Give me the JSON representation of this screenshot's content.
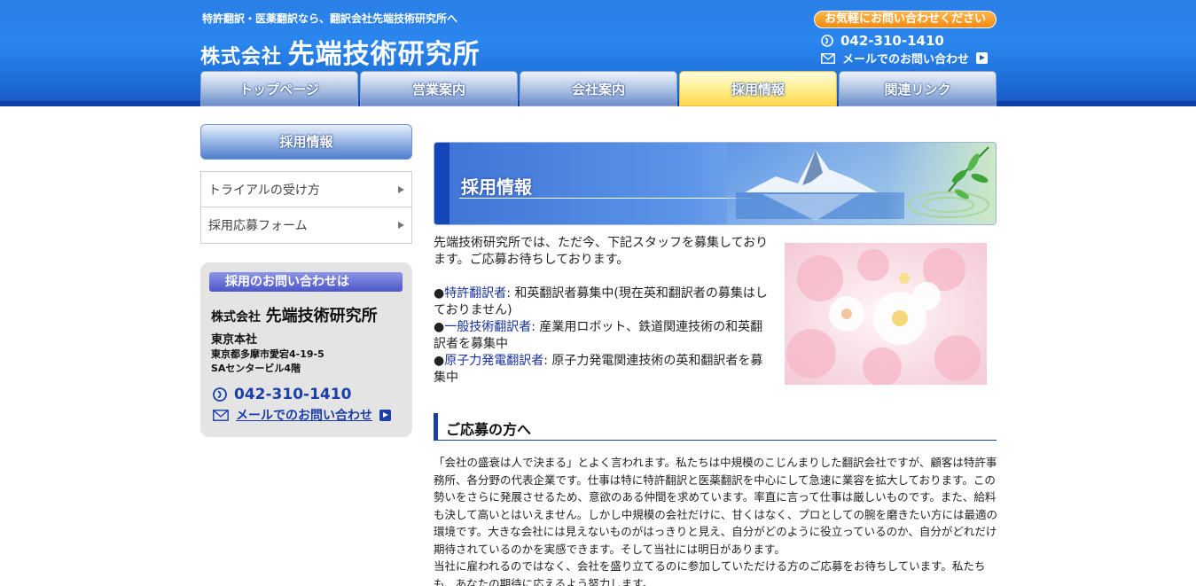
{
  "header": {
    "tagline": "特許翻訳・医薬翻訳なら、翻訳会社先端技術研究所へ",
    "brand_prefix": "株式会社",
    "brand_name": "先端技術研究所",
    "contact_pill": "お気軽にお問い合わせください",
    "phone": "042-310-1410",
    "mail_link": "メールでのお問い合わせ"
  },
  "nav": {
    "tabs": [
      {
        "label": "トップページ",
        "active": false
      },
      {
        "label": "営業案内",
        "active": false
      },
      {
        "label": "会社案内",
        "active": false
      },
      {
        "label": "採用情報",
        "active": true
      },
      {
        "label": "関連リンク",
        "active": false
      }
    ]
  },
  "sidebar": {
    "heading": "採用情報",
    "menu": [
      {
        "label": "トライアルの受け方"
      },
      {
        "label": "採用応募フォーム"
      }
    ],
    "contact": {
      "label": "採用のお問い合わせは",
      "company_prefix": "株式会社",
      "company_name": "先端技術研究所",
      "office": "東京本社",
      "address_line1": "東京都多摩市愛宕4-19-5",
      "address_line2": "SAセンタービル4階",
      "phone": "042-310-1410",
      "mail_link": "メールでのお問い合わせ"
    }
  },
  "main": {
    "banner_title": "採用情報",
    "intro": "先端技術研究所では、ただ今、下記スタッフを募集しております。ご応募お待ちしております。",
    "positions": [
      {
        "bullet": "●",
        "link": "特許翻訳者",
        "desc": ": 和英翻訳者募集中(現在英和翻訳者の募集はしておりません)"
      },
      {
        "bullet": "●",
        "link": "一般技術翻訳者",
        "desc": ": 産業用ロボット、鉄道関連技術の和英翻訳者を募集中"
      },
      {
        "bullet": "●",
        "link": "原子力発電翻訳者",
        "desc": ": 原子力発電関連技術の英和翻訳者を募集中"
      }
    ],
    "section_title": "ご応募の方へ",
    "body_p1": "「会社の盛衰は人で決まる」とよく言われます。私たちは中規模のこじんまりした翻訳会社ですが、顧客は特許事務所、各分野の代表企業です。仕事は特に特許翻訳と医薬翻訳を中心にして急速に業容を拡大しております。この勢いをさらに発展させるため、意欲のある仲間を求めています。率直に言って仕事は厳しいものです。また、給料も決して高いとはいえません。しかし中規模の会社だけに、甘くはなく、プロとしての腕を磨きたい方には最適の環境です。大きな会社には見えないものがはっきりと見え、自分がどのように役立っているのか、自分がどれだけ期待されているのかを実感できます。そして当社には明日があります。",
    "body_p2": "当社に雇われるのではなく、会社を盛り立てるのに参加していただける方のご応募をお待ちしています。私たちも、あなたの期待に応えるよう努力します。"
  }
}
